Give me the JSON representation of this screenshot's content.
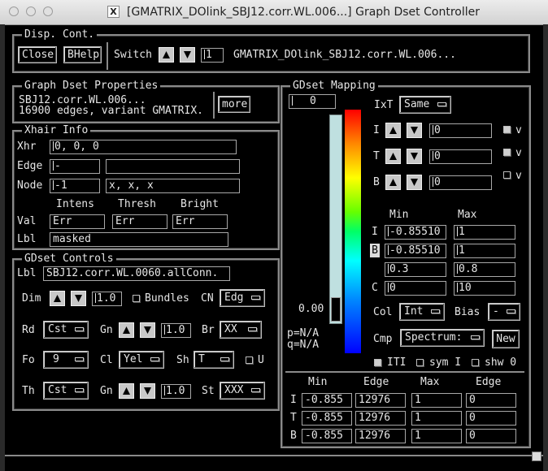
{
  "window": {
    "title": "[GMATRIX_DOlink_SBJ12.corr.WL.006...] Graph Dset Controller"
  },
  "disp_cont": {
    "title": "Disp. Cont.",
    "close_label": "Close",
    "bhelp_label": "BHelp",
    "switch_label": "Switch",
    "switch_value": "1",
    "dset_name": "GMATRIX_DOlink_SBJ12.corr.WL.006..."
  },
  "properties": {
    "title": "Graph Dset Properties",
    "line1": "SBJ12.corr.WL.006...",
    "line2": "16900 edges, variant GMATRIX.",
    "more_label": "more"
  },
  "xhair": {
    "title": "Xhair Info",
    "xhr_label": "Xhr",
    "xhr_value": "0, 0, 0",
    "edge_label": "Edge",
    "edge_value": "-",
    "edge_value2": "",
    "node_label": "Node",
    "node_value": "-1",
    "node_value2": "x, x, x",
    "col_intens": "Intens",
    "col_thresh": "Thresh",
    "col_bright": "Bright",
    "val_label": "Val",
    "val_intens": "Err",
    "val_thresh": "Err",
    "val_bright": "Err",
    "lbl_label": "Lbl",
    "lbl_value": "masked"
  },
  "controls": {
    "title": "GDset Controls",
    "lbl_label": "Lbl",
    "lbl_value": "SBJ12.corr.WL.0060.allConn.",
    "dim_label": "Dim",
    "dim_value": "1.0",
    "bundles_label": "Bundles",
    "cn_label": "CN",
    "cn_value": "Edg",
    "rd_label": "Rd",
    "rd_value": "Cst",
    "gn_label": "Gn",
    "gn_value": "1.0",
    "br_label": "Br",
    "br_value": "XX",
    "fo_label": "Fo",
    "fo_value": "9",
    "cl_label": "Cl",
    "cl_value": "Yel",
    "sh_label": "Sh",
    "sh_value": "T",
    "u_label": "U",
    "th_label": "Th",
    "th_value": "Cst",
    "gn2_label": "Gn",
    "gn2_value": "1.0",
    "st_label": "St",
    "st_value": "XXX"
  },
  "mapping": {
    "title": "GDset Mapping",
    "top_value": "0",
    "ixt_label": "IxT",
    "ixt_value": "Same",
    "i_label": "I",
    "i_value": "0",
    "t_label": "T",
    "t_value": "0",
    "b_label": "B",
    "b_value": "0",
    "v_label": "v",
    "min_header": "Min",
    "max_header": "Max",
    "row_i_label": "I",
    "row_i_min": "-0.85510",
    "row_i_max": "1",
    "row_b_label": "B",
    "row_b_min": "-0.85510",
    "row_b_max": "1",
    "row3_min": "0.3",
    "row3_max": "0.8",
    "row_c_label": "C",
    "row_c_min": "0",
    "row_c_max": "10",
    "slider_value": "0.00",
    "p_readout": "p=N/A",
    "q_readout": "q=N/A",
    "col_label": "Col",
    "col_value": "Int",
    "bias_label": "Bias",
    "bias_value": "-",
    "cmp_label": "Cmp",
    "cmp_value": "Spectrum:",
    "new_label": "New",
    "iti_label": "ITI",
    "sym_label": "sym I",
    "shw_label": "shw 0",
    "table_headers": [
      "Min",
      "Edge",
      "Max",
      "Edge"
    ],
    "table_rows": [
      {
        "label": "I",
        "min": "-0.855",
        "edge1": "12976",
        "max": "1",
        "edge2": "0"
      },
      {
        "label": "T",
        "min": "-0.855",
        "edge1": "12976",
        "max": "1",
        "edge2": "0"
      },
      {
        "label": "B",
        "min": "-0.855",
        "edge1": "12976",
        "max": "1",
        "edge2": "0"
      }
    ]
  },
  "colors": {
    "background": "#000000",
    "text": "#e6e6e6",
    "slider_trough": "#bfe0e0",
    "frame": "#8a8a8a"
  }
}
